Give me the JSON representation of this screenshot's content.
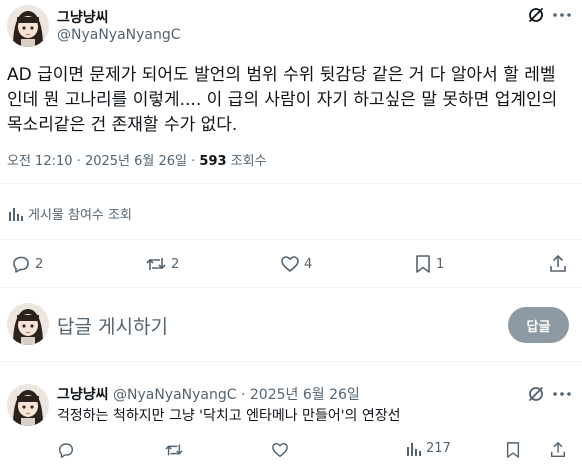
{
  "post": {
    "author_name": "그냥냥씨",
    "author_handle": "@NyaNyaNyangC",
    "body": "AD 급이면 문제가 되어도 발언의 범위 수위 뒷감당 같은 거 다 알아서 할 레벨인데 뭔 고나리를 이렇게.... 이 급의 사람이 자기 하고싶은 말 못하면 업계인의 목소리같은 건 존재할 수가 없다.",
    "time": "오전 12:10",
    "sep": "·",
    "date": "2025년 6월 26일",
    "views_count": "593",
    "views_label": "조회수",
    "engagement_label": "게시물 참여수 조회",
    "actions": {
      "replies": "2",
      "reposts": "2",
      "likes": "4",
      "bookmarks": "1"
    },
    "menu_icon": "grok-slash-icon"
  },
  "composer": {
    "placeholder": "답글 게시하기",
    "button_label": "답글"
  },
  "reply": {
    "author_name": "그냥냥씨",
    "author_handle": "@NyaNyaNyangC",
    "sep": "·",
    "date": "2025년 6월 26일",
    "body": "걱정하는 척하지만 그냥 '닥치고 엔타메나 만들어'의 연장선",
    "actions": {
      "views": "217"
    }
  },
  "colors": {
    "text": "#0f1419",
    "muted": "#536471",
    "divider": "#eff3f4",
    "button_disabled": "#8e9aa3"
  }
}
